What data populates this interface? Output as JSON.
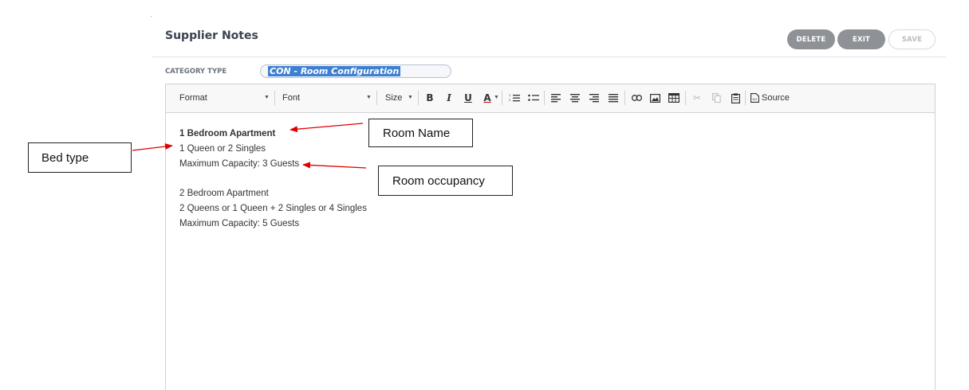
{
  "header": {
    "title": "Supplier Notes",
    "buttons": {
      "delete": "DELETE",
      "exit": "EXIT",
      "save": "SAVE"
    }
  },
  "category": {
    "label": "CATEGORY TYPE",
    "value": "CON - Room Configuration"
  },
  "toolbar": {
    "format": "Format",
    "font": "Font",
    "size": "Size",
    "bold": "B",
    "italic": "I",
    "underline": "U",
    "text_color": "A",
    "source": "Source",
    "icons": [
      "numbered-list-icon",
      "bulleted-list-icon",
      "align-left-icon",
      "align-center-icon",
      "align-right-icon",
      "justify-icon",
      "link-icon",
      "image-icon",
      "table-icon",
      "cut-icon",
      "copy-icon",
      "paste-icon",
      "source-icon"
    ]
  },
  "content": {
    "lines": [
      "1 Bedroom Apartment",
      "1 Queen or 2 Singles",
      "Maximum Capacity: 3 Guests",
      "2 Bedroom Apartment",
      "2 Queens or 1 Queen + 2 Singles or 4 Singles",
      "Maximum Capacity: 5 Guests"
    ]
  },
  "annotations": {
    "room_name": "Room Name",
    "bed_type": "Bed type",
    "room_occupancy": "Room occupancy",
    "arrow_color": "#e00000"
  }
}
